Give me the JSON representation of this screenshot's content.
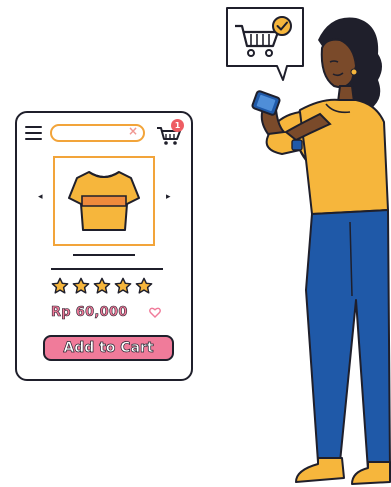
{
  "search": {
    "value": "",
    "clear_icon": "×"
  },
  "cart": {
    "badge_count": "1"
  },
  "product": {
    "price": "Rp 60,000",
    "rating": {
      "filled": 5,
      "max": 5
    },
    "add_to_cart_label": "Add to Cart",
    "prev_icon": "◂",
    "next_icon": "▸"
  },
  "colors": {
    "accent_orange": "#f2a43a",
    "accent_pink": "#f07b9a",
    "badge_red": "#ee5d63",
    "shirt_yellow": "#f6b63c",
    "outline": "#1f1f2b",
    "jeans_blue": "#1f59a8",
    "skin": "#7a4a2a"
  },
  "icons": [
    "menu-icon",
    "clear-icon",
    "cart-icon",
    "shirt-image",
    "star-icon",
    "heart-icon",
    "bubble-cart-icon",
    "check-icon",
    "smartphone"
  ]
}
